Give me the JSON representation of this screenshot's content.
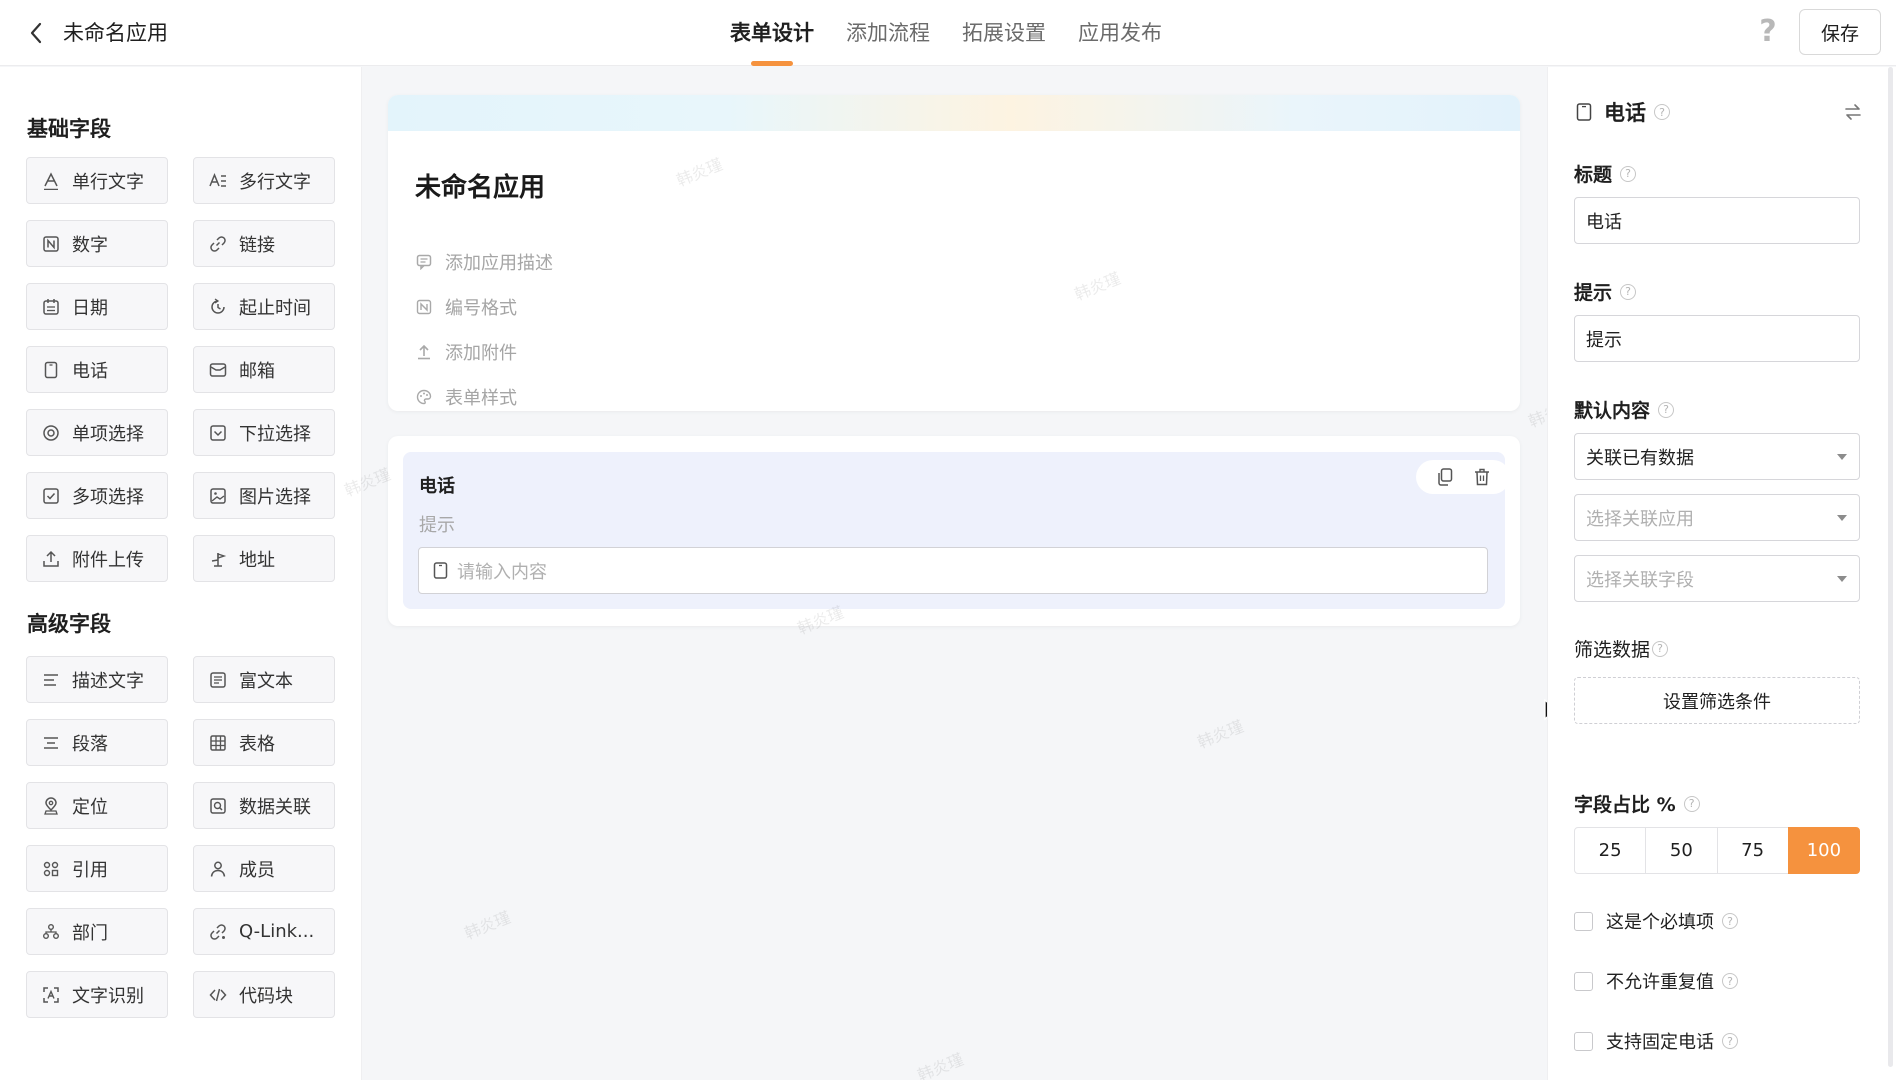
{
  "topbar": {
    "app_title": "未命名应用",
    "tabs": [
      {
        "label": "表单设计",
        "active": true
      },
      {
        "label": "添加流程",
        "active": false
      },
      {
        "label": "拓展设置",
        "active": false
      },
      {
        "label": "应用发布",
        "active": false
      }
    ],
    "help_label": "?",
    "save_label": "保存",
    "accent_color": "#f5923e"
  },
  "sidebar": {
    "basic_title": "基础字段",
    "basic_fields": [
      {
        "label": "单行文字",
        "icon": "single-line-text-icon"
      },
      {
        "label": "多行文字",
        "icon": "multi-line-text-icon"
      },
      {
        "label": "数字",
        "icon": "number-icon"
      },
      {
        "label": "链接",
        "icon": "link-icon"
      },
      {
        "label": "日期",
        "icon": "calendar-icon"
      },
      {
        "label": "起止时间",
        "icon": "time-range-icon"
      },
      {
        "label": "电话",
        "icon": "phone-icon"
      },
      {
        "label": "邮箱",
        "icon": "mail-icon"
      },
      {
        "label": "单项选择",
        "icon": "radio-icon"
      },
      {
        "label": "下拉选择",
        "icon": "dropdown-icon"
      },
      {
        "label": "多项选择",
        "icon": "checkbox-icon"
      },
      {
        "label": "图片选择",
        "icon": "image-icon"
      },
      {
        "label": "附件上传",
        "icon": "upload-icon"
      },
      {
        "label": "地址",
        "icon": "address-icon"
      }
    ],
    "advanced_title": "高级字段",
    "advanced_fields": [
      {
        "label": "描述文字",
        "icon": "description-icon"
      },
      {
        "label": "富文本",
        "icon": "rich-text-icon"
      },
      {
        "label": "段落",
        "icon": "paragraph-icon"
      },
      {
        "label": "表格",
        "icon": "table-icon"
      },
      {
        "label": "定位",
        "icon": "location-icon"
      },
      {
        "label": "数据关联",
        "icon": "data-link-icon"
      },
      {
        "label": "引用",
        "icon": "reference-icon"
      },
      {
        "label": "成员",
        "icon": "member-icon"
      },
      {
        "label": "部门",
        "icon": "department-icon"
      },
      {
        "label": "Q-Link...",
        "icon": "qlink-icon"
      },
      {
        "label": "文字识别",
        "icon": "ocr-icon"
      },
      {
        "label": "代码块",
        "icon": "code-icon"
      }
    ]
  },
  "canvas": {
    "form_title": "未命名应用",
    "meta_items": [
      {
        "label": "添加应用描述",
        "icon": "comment-icon"
      },
      {
        "label": "编号格式",
        "icon": "number-format-icon"
      },
      {
        "label": "添加附件",
        "icon": "attachment-upload-icon"
      },
      {
        "label": "表单样式",
        "icon": "palette-icon"
      }
    ],
    "field": {
      "label": "电话",
      "hint": "提示",
      "input_placeholder": "请输入内容"
    },
    "watermark": "韩炎瑾"
  },
  "panel": {
    "field_type": "电话",
    "title_label": "标题",
    "title_value": "电话",
    "hint_label": "提示",
    "hint_value": "提示",
    "default_label": "默认内容",
    "default_select": "关联已有数据",
    "app_select_placeholder": "选择关联应用",
    "field_select_placeholder": "选择关联字段",
    "filter_label": "筛选数据",
    "filter_button": "设置筛选条件",
    "ratio_label": "字段占比 %",
    "ratio_options": [
      "25",
      "50",
      "75",
      "100"
    ],
    "ratio_selected": "100",
    "checks": [
      {
        "label": "这是个必填项",
        "checked": false
      },
      {
        "label": "不允许重复值",
        "checked": false
      },
      {
        "label": "支持固定电话",
        "checked": false
      }
    ]
  }
}
